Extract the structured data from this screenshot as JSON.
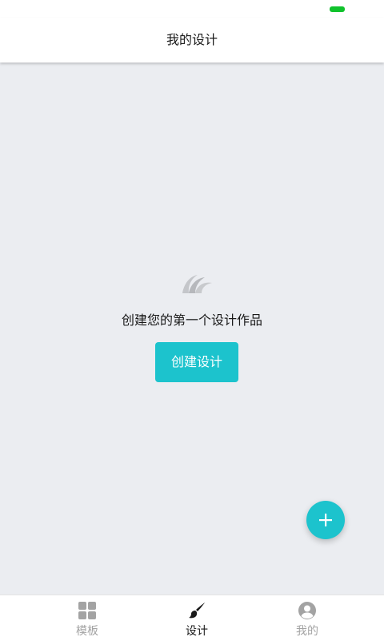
{
  "colors": {
    "accent": "#1cc3cd",
    "battery": "#10c22c",
    "tab_inactive": "#a3a3a3",
    "tab_active": "#1a1a1a"
  },
  "header": {
    "title": "我的设计"
  },
  "empty_state": {
    "icon": "logo-wave-icon",
    "message": "创建您的第一个设计作品",
    "button_label": "创建设计"
  },
  "fab": {
    "icon": "plus-icon"
  },
  "tabbar": {
    "items": [
      {
        "label": "模板",
        "icon": "grid-icon",
        "active": false
      },
      {
        "label": "设计",
        "icon": "brush-icon",
        "active": true
      },
      {
        "label": "我的",
        "icon": "user-icon",
        "active": false
      }
    ]
  }
}
